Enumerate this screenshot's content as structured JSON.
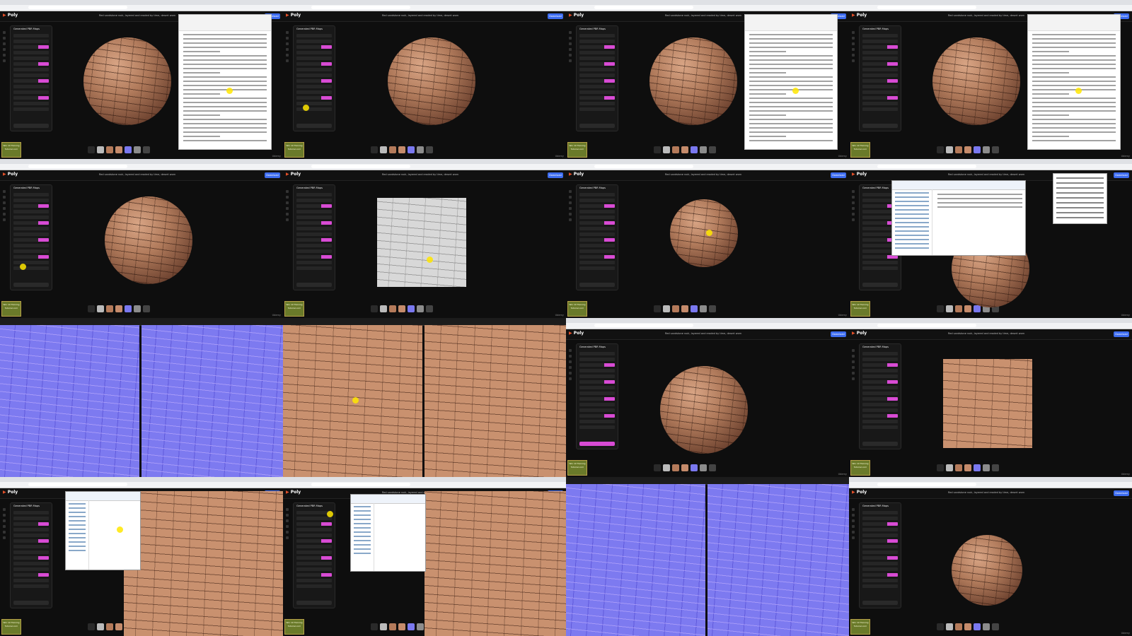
{
  "app": {
    "name": "Poly",
    "prompt": "Red sandstone rock, layered and eroded by time, desert worn",
    "download_label": "Download",
    "panel_title": "Generated PBR Maps",
    "watermark": "Udemy",
    "badge_text": "Win 10 Training Tutorial.com"
  },
  "tiles": [
    {
      "kind": "sphere-doc"
    },
    {
      "kind": "sphere"
    },
    {
      "kind": "sphere-doc"
    },
    {
      "kind": "sphere-doc"
    },
    {
      "kind": "sphere"
    },
    {
      "kind": "height-map"
    },
    {
      "kind": "sphere-small"
    },
    {
      "kind": "explorer"
    },
    {
      "kind": "normal-split"
    },
    {
      "kind": "texture-split"
    },
    {
      "kind": "sphere-generate"
    },
    {
      "kind": "texture-flat"
    },
    {
      "kind": "explorer-texture"
    },
    {
      "kind": "explorer-texture2"
    },
    {
      "kind": "normal-split"
    },
    {
      "kind": "sphere-mid"
    },
    {
      "kind": "sphere-right"
    }
  ],
  "colors": {
    "accent": "#d84bd4",
    "brand": "#e4512a",
    "button": "#3d6cf0",
    "swatches": [
      "#2a2a2a",
      "#bbbbbb",
      "#b47a5a",
      "#c58b6b",
      "#7a78ef",
      "#8c8c8c",
      "#444444"
    ]
  }
}
